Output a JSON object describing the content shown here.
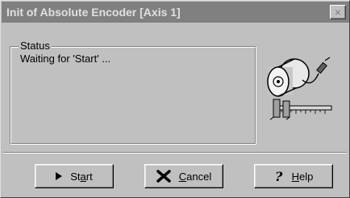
{
  "window": {
    "title": "Init of Absolute Encoder [Axis 1]",
    "close_label": "×"
  },
  "status": {
    "legend": "Status",
    "message": "Waiting for 'Start' ..."
  },
  "buttons": {
    "start": {
      "pre": "St",
      "mnemonic": "a",
      "post": "rt",
      "icon": "play-triangle-icon"
    },
    "cancel": {
      "pre": "",
      "mnemonic": "C",
      "post": "ancel",
      "icon": "x-mark-icon"
    },
    "help": {
      "pre": "",
      "mnemonic": "H",
      "post": "elp",
      "icon": "question-mark-icon"
    }
  },
  "colors": {
    "face": "#c0c0c0",
    "titlebar_inactive": "#808080",
    "title_text": "#e0e0e0"
  }
}
